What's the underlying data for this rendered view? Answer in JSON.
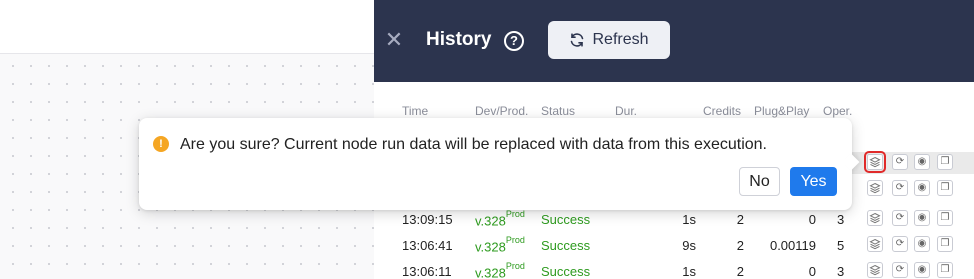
{
  "panel": {
    "title": "History",
    "help_icon": "question-circle-icon",
    "close_icon": "close-icon",
    "refresh_label": "Refresh",
    "refresh_icon": "refresh-icon"
  },
  "table": {
    "headers": [
      "Time",
      "Dev/Prod.",
      "Status",
      "Dur.",
      "Credits",
      "Plug&Play",
      "Oper."
    ],
    "rows": [
      {
        "time": "",
        "version": "",
        "env": "",
        "status": "",
        "duration": "",
        "credits": "",
        "plugplay": "",
        "oper": ""
      },
      {
        "time": "",
        "version": "",
        "env": "",
        "status": "",
        "duration": "",
        "credits": "",
        "plugplay": "",
        "oper": ""
      },
      {
        "time": "13:09:15",
        "version": "v.328",
        "env": "Prod",
        "status": "Success",
        "duration": "1s",
        "credits": "2",
        "plugplay": "0",
        "oper": "3"
      },
      {
        "time": "13:06:41",
        "version": "v.328",
        "env": "Prod",
        "status": "Success",
        "duration": "9s",
        "credits": "2",
        "plugplay": "0.00119",
        "oper": "5"
      },
      {
        "time": "13:06:11",
        "version": "v.328",
        "env": "Prod",
        "status": "Success",
        "duration": "1s",
        "credits": "2",
        "plugplay": "0",
        "oper": "3"
      }
    ],
    "row_action_icons": [
      "layers-icon",
      "rerun-icon",
      "eye-icon",
      "copy-icon"
    ]
  },
  "confirm": {
    "icon": "warning-icon",
    "message": "Are you sure? Current node run data will be replaced with data from this execution.",
    "no_label": "No",
    "yes_label": "Yes"
  },
  "colors": {
    "header_bg": "#2c344e",
    "success": "#2e9b1f",
    "primary": "#1f7aec",
    "warning": "#f5a623",
    "selected_outline": "#e02a2a"
  }
}
